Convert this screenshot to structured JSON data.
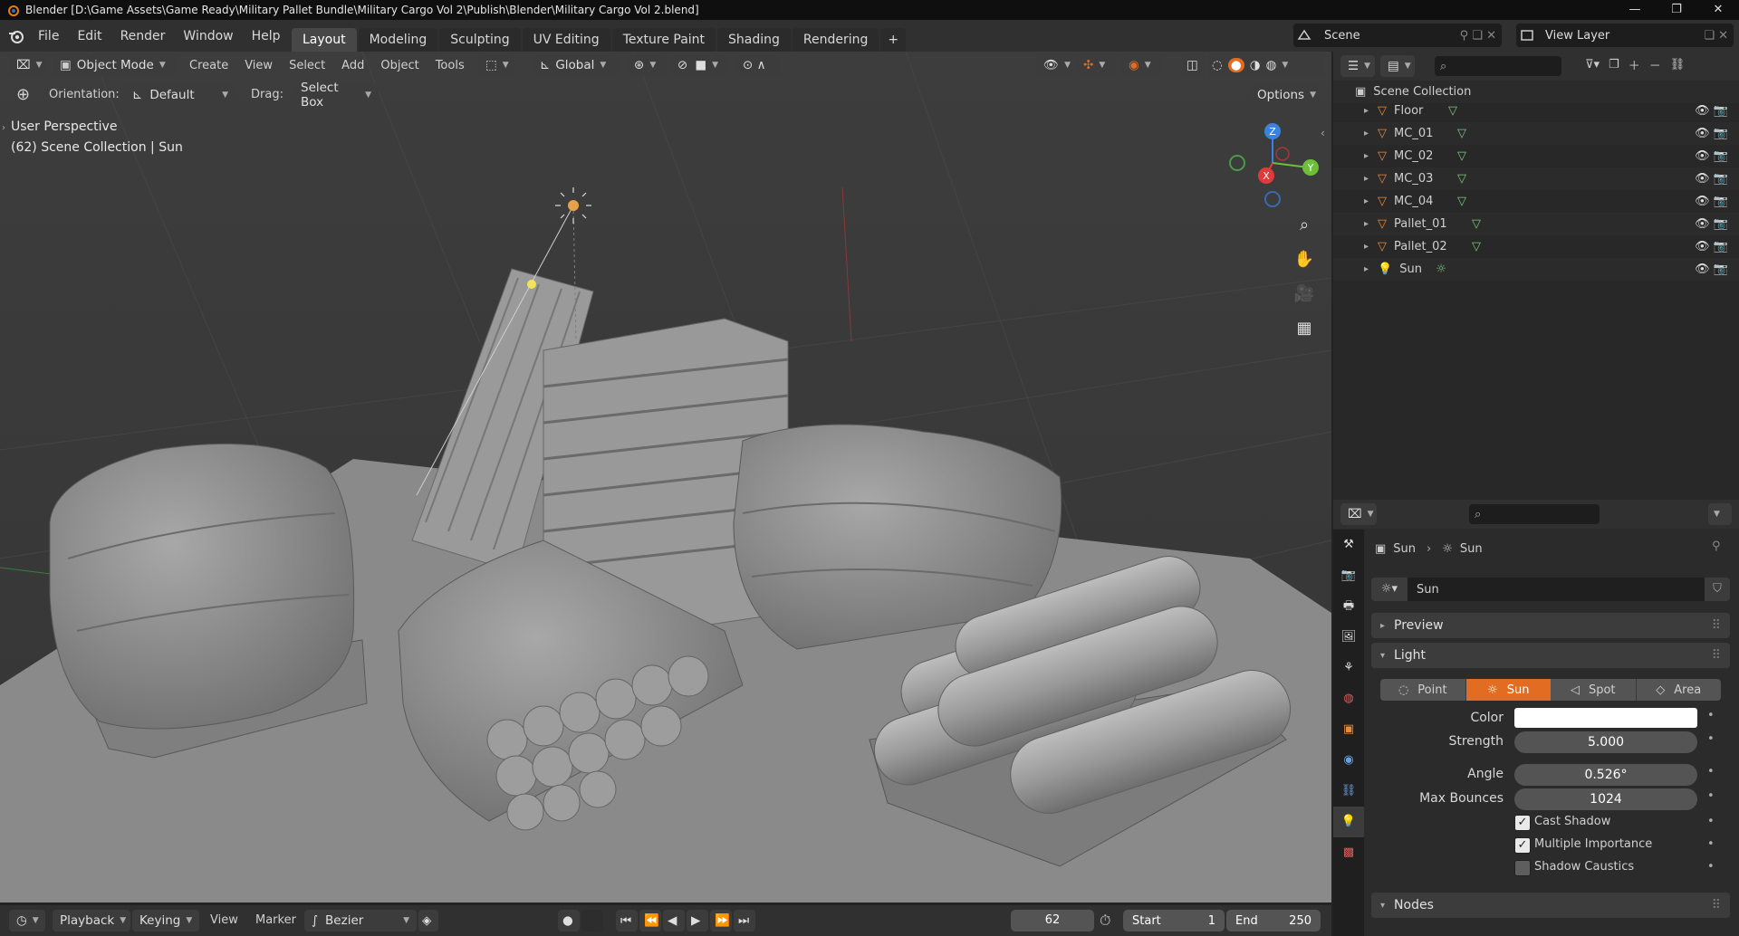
{
  "window": {
    "title": "Blender [D:\\Game Assets\\Game Ready\\Military Pallet Bundle\\Military Cargo Vol 2\\Publish\\Blender\\Military Cargo Vol 2.blend]",
    "controls": [
      "—",
      "❐",
      "✕"
    ]
  },
  "menu": [
    "File",
    "Edit",
    "Render",
    "Window",
    "Help"
  ],
  "workspaces": [
    "Layout",
    "Modeling",
    "Sculpting",
    "UV Editing",
    "Texture Paint",
    "Shading",
    "Rendering"
  ],
  "add_tab": "+",
  "scene": {
    "name": "Scene",
    "view_layer": "View Layer"
  },
  "viewport_header": {
    "mode": "Object Mode",
    "menus": [
      "Create",
      "View",
      "Select",
      "Add",
      "Object",
      "Tools"
    ],
    "transform": "Global"
  },
  "tool_settings": {
    "orientation_label": "Orientation:",
    "orientation_value": "Default",
    "drag_label": "Drag:",
    "drag_value": "Select Box",
    "options": "Options"
  },
  "viewport_info": {
    "perspective": "User Perspective",
    "collection": "(62) Scene Collection | Sun"
  },
  "gizmo": {
    "x": "X",
    "y": "Y",
    "z": "Z",
    "colors": {
      "x": "#e03a3a",
      "y": "#6dbf3a",
      "z": "#3a82e0"
    }
  },
  "outliner": {
    "root": "Scene Collection",
    "items": [
      {
        "name": "Floor",
        "type": "mesh"
      },
      {
        "name": "MC_01",
        "type": "mesh"
      },
      {
        "name": "MC_02",
        "type": "mesh"
      },
      {
        "name": "MC_03",
        "type": "mesh"
      },
      {
        "name": "MC_04",
        "type": "mesh"
      },
      {
        "name": "Pallet_01",
        "type": "mesh"
      },
      {
        "name": "Pallet_02",
        "type": "mesh"
      },
      {
        "name": "Sun",
        "type": "light"
      }
    ]
  },
  "properties": {
    "breadcrumb": [
      "Sun",
      "Sun"
    ],
    "datablock": "Sun",
    "panels": {
      "preview": "Preview",
      "light": "Light",
      "nodes": "Nodes"
    },
    "light_types": [
      "Point",
      "Sun",
      "Spot",
      "Area"
    ],
    "active_light_type": "Sun",
    "fields": {
      "color_label": "Color",
      "color_value": "#ffffff",
      "strength_label": "Strength",
      "strength_value": "5.000",
      "angle_label": "Angle",
      "angle_value": "0.526°",
      "bounces_label": "Max Bounces",
      "bounces_value": "1024"
    },
    "checkboxes": [
      {
        "label": "Cast Shadow",
        "checked": true
      },
      {
        "label": "Multiple Importance",
        "checked": true
      },
      {
        "label": "Shadow Caustics",
        "checked": false
      }
    ]
  },
  "timeline": {
    "menus": [
      "Playback",
      "Keying",
      "View",
      "Marker"
    ],
    "interpolation": "Bezier",
    "current_frame": "62",
    "start_label": "Start",
    "start": "1",
    "end_label": "End",
    "end": "250"
  },
  "accent": "#e26d22"
}
